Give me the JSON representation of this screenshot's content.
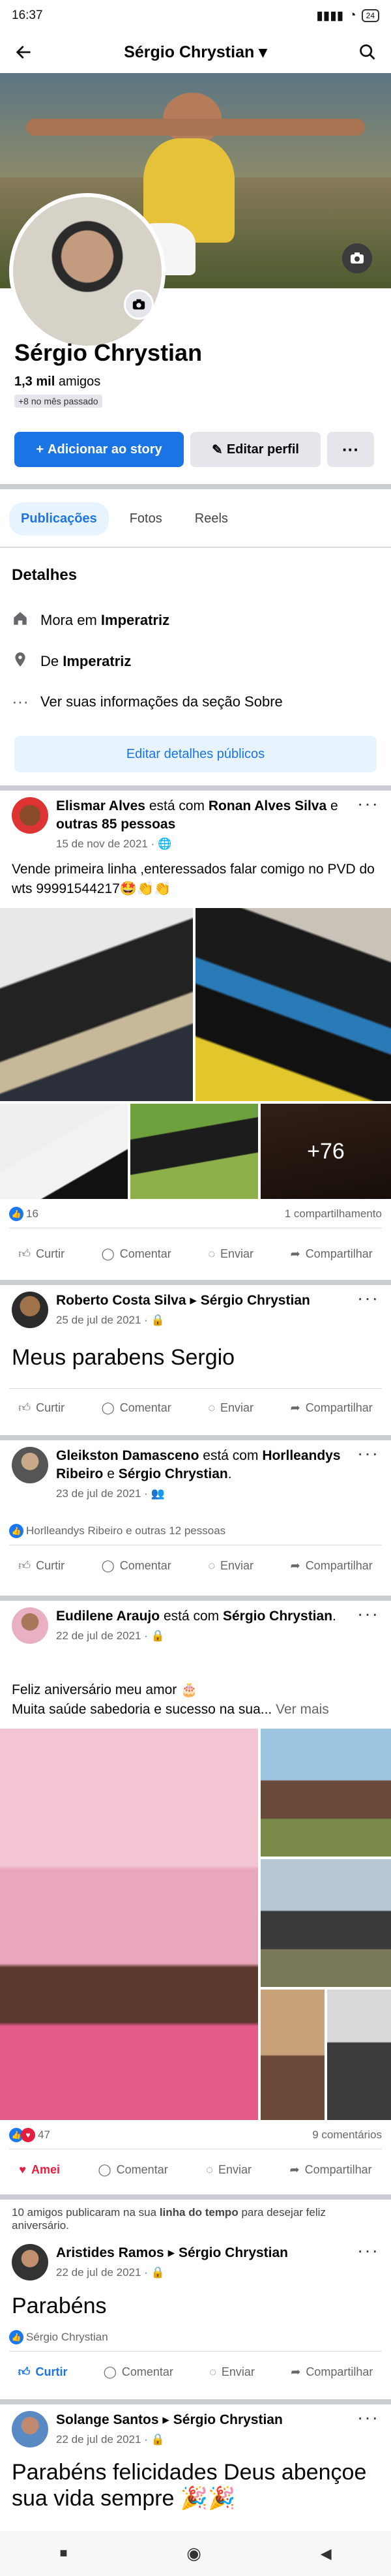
{
  "status": {
    "time": "16:37",
    "battery": "24"
  },
  "header": {
    "title": "Sérgio Chrystian"
  },
  "profile": {
    "name": "Sérgio Chrystian",
    "friends_count": "1,3 mil",
    "friends_label": "amigos",
    "new_badge": "+8 no mês passado"
  },
  "actions": {
    "add_story": "Adicionar ao story",
    "edit_profile": "Editar perfil",
    "more": "···"
  },
  "tabs": [
    "Publicações",
    "Fotos",
    "Reels"
  ],
  "details": {
    "title": "Detalhes",
    "lives_prefix": "Mora em",
    "lives": "Imperatriz",
    "from_prefix": "De",
    "from": "Imperatriz",
    "about": "Ver suas informações da seção Sobre",
    "edit": "Editar detalhes públicos"
  },
  "post1": {
    "author": "Elismar Alves",
    "verb": "está com",
    "with": "Ronan Alves Silva",
    "and": "e",
    "others": "outras 85 pessoas",
    "date": "15 de nov de 2021 ·",
    "text": "Vende primeira linha ,enteressados falar comigo no PVD do wts 99991544217🤩👏👏",
    "more_photos": "+76",
    "likes": "16",
    "shares": "1 compartilhamento"
  },
  "bar": {
    "like": "Curtir",
    "comment": "Comentar",
    "send": "Enviar",
    "share": "Compartilhar",
    "loved": "Amei"
  },
  "post2": {
    "author": "Roberto Costa Silva",
    "arrow": "▸",
    "target": "Sérgio Chrystian",
    "date": "25 de jul de 2021 ·",
    "text": "Meus parabens Sergio"
  },
  "post3": {
    "author": "Gleikston Damasceno",
    "verb": "está com",
    "with1": "Horlleandys Ribeiro",
    "and": "e",
    "with2": "Sérgio Chrystian",
    "date": "23 de jul de 2021 ·",
    "likes_text": "Horlleandys Ribeiro e outras 12 pessoas"
  },
  "post4": {
    "author": "Eudilene Araujo",
    "verb": "está com",
    "with": "Sérgio Chrystian",
    "date": "22 de jul de 2021 ·",
    "line1": "Feliz aniversário meu amor 🎂",
    "line2": "Muita saúde sabedoria e sucesso na sua...",
    "see_more": "Ver mais",
    "reactions": "47",
    "comments": "9 comentários"
  },
  "birthday": {
    "text": "10 amigos publicaram na sua",
    "link": "linha do tempo",
    "text2": "para desejar feliz aniversário."
  },
  "post5": {
    "author": "Aristides Ramos",
    "arrow": "▸",
    "target": "Sérgio Chrystian",
    "date": "22 de jul de 2021 ·",
    "text": "Parabéns",
    "likes_text": "Sérgio Chrystian"
  },
  "post6": {
    "author": "Solange Santos",
    "arrow": "▸",
    "target": "Sérgio Chrystian",
    "date": "22 de jul de 2021 ·",
    "text": "Parabéns felicidades Deus abençoe sua vida sempre 🎉🎉"
  },
  "colors": {
    "accent": "#1b74e4",
    "love": "#e41e3f"
  }
}
